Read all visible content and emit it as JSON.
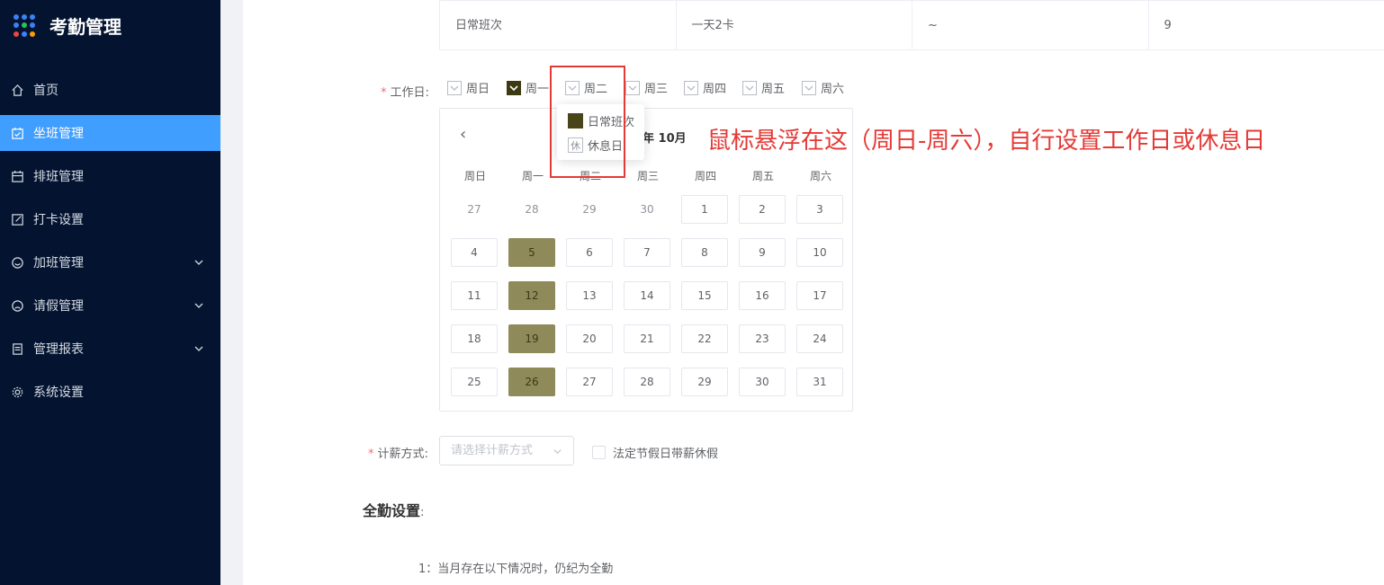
{
  "app": {
    "title": "考勤管理"
  },
  "sidebar": {
    "items": [
      {
        "label": "首页",
        "icon": "home-icon"
      },
      {
        "label": "坐班管理",
        "icon": "calendar-check-icon",
        "active": true
      },
      {
        "label": "排班管理",
        "icon": "calendar-icon"
      },
      {
        "label": "打卡设置",
        "icon": "edit-icon"
      },
      {
        "label": "加班管理",
        "icon": "smile-icon",
        "has_submenu": true
      },
      {
        "label": "请假管理",
        "icon": "sad-icon",
        "has_submenu": true
      },
      {
        "label": "管理报表",
        "icon": "report-icon",
        "has_submenu": true
      },
      {
        "label": "系统设置",
        "icon": "gear-icon"
      }
    ]
  },
  "table": {
    "row": [
      "日常班次",
      "一天2卡",
      "~",
      "9"
    ]
  },
  "form": {
    "workday_label": "工作日:",
    "weekdays": [
      {
        "label": "周日",
        "checked": false
      },
      {
        "label": "周一",
        "checked": true
      },
      {
        "label": "周二",
        "checked": false
      },
      {
        "label": "周三",
        "checked": false
      },
      {
        "label": "周四",
        "checked": false
      },
      {
        "label": "周五",
        "checked": false
      },
      {
        "label": "周六",
        "checked": false
      }
    ],
    "salary_label": "计薪方式:",
    "salary_placeholder": "请选择计薪方式",
    "holiday_paid_label": "法定节假日带薪休假"
  },
  "calendar": {
    "title_visible": "年 10月",
    "week_headers": [
      "周日",
      "周一",
      "周二",
      "周三",
      "周四",
      "周五",
      "周六"
    ],
    "weeks": [
      [
        "27",
        "28",
        "29",
        "30",
        "1",
        "2",
        "3"
      ],
      [
        "4",
        "5",
        "6",
        "7",
        "8",
        "9",
        "10"
      ],
      [
        "11",
        "12",
        "13",
        "14",
        "15",
        "16",
        "17"
      ],
      [
        "18",
        "19",
        "20",
        "21",
        "22",
        "23",
        "24"
      ],
      [
        "25",
        "26",
        "27",
        "28",
        "29",
        "30",
        "31"
      ]
    ],
    "prev_month_count": 4,
    "work_column": 1
  },
  "popover": {
    "work_label": "日常班次",
    "rest_icon": "休",
    "rest_label": "休息日"
  },
  "annotation": "鼠标悬浮在这（周日-周六），自行设置工作日或休息日",
  "full_attendance": {
    "title": "全勤设置",
    "colon": ":",
    "note": "1：当月存在以下情况时，仍纪为全勤"
  },
  "colors": {
    "sidebar_bg": "#041430",
    "active": "#409eff",
    "work_cell": "#8f8a5a",
    "annotation": "#e53935"
  }
}
